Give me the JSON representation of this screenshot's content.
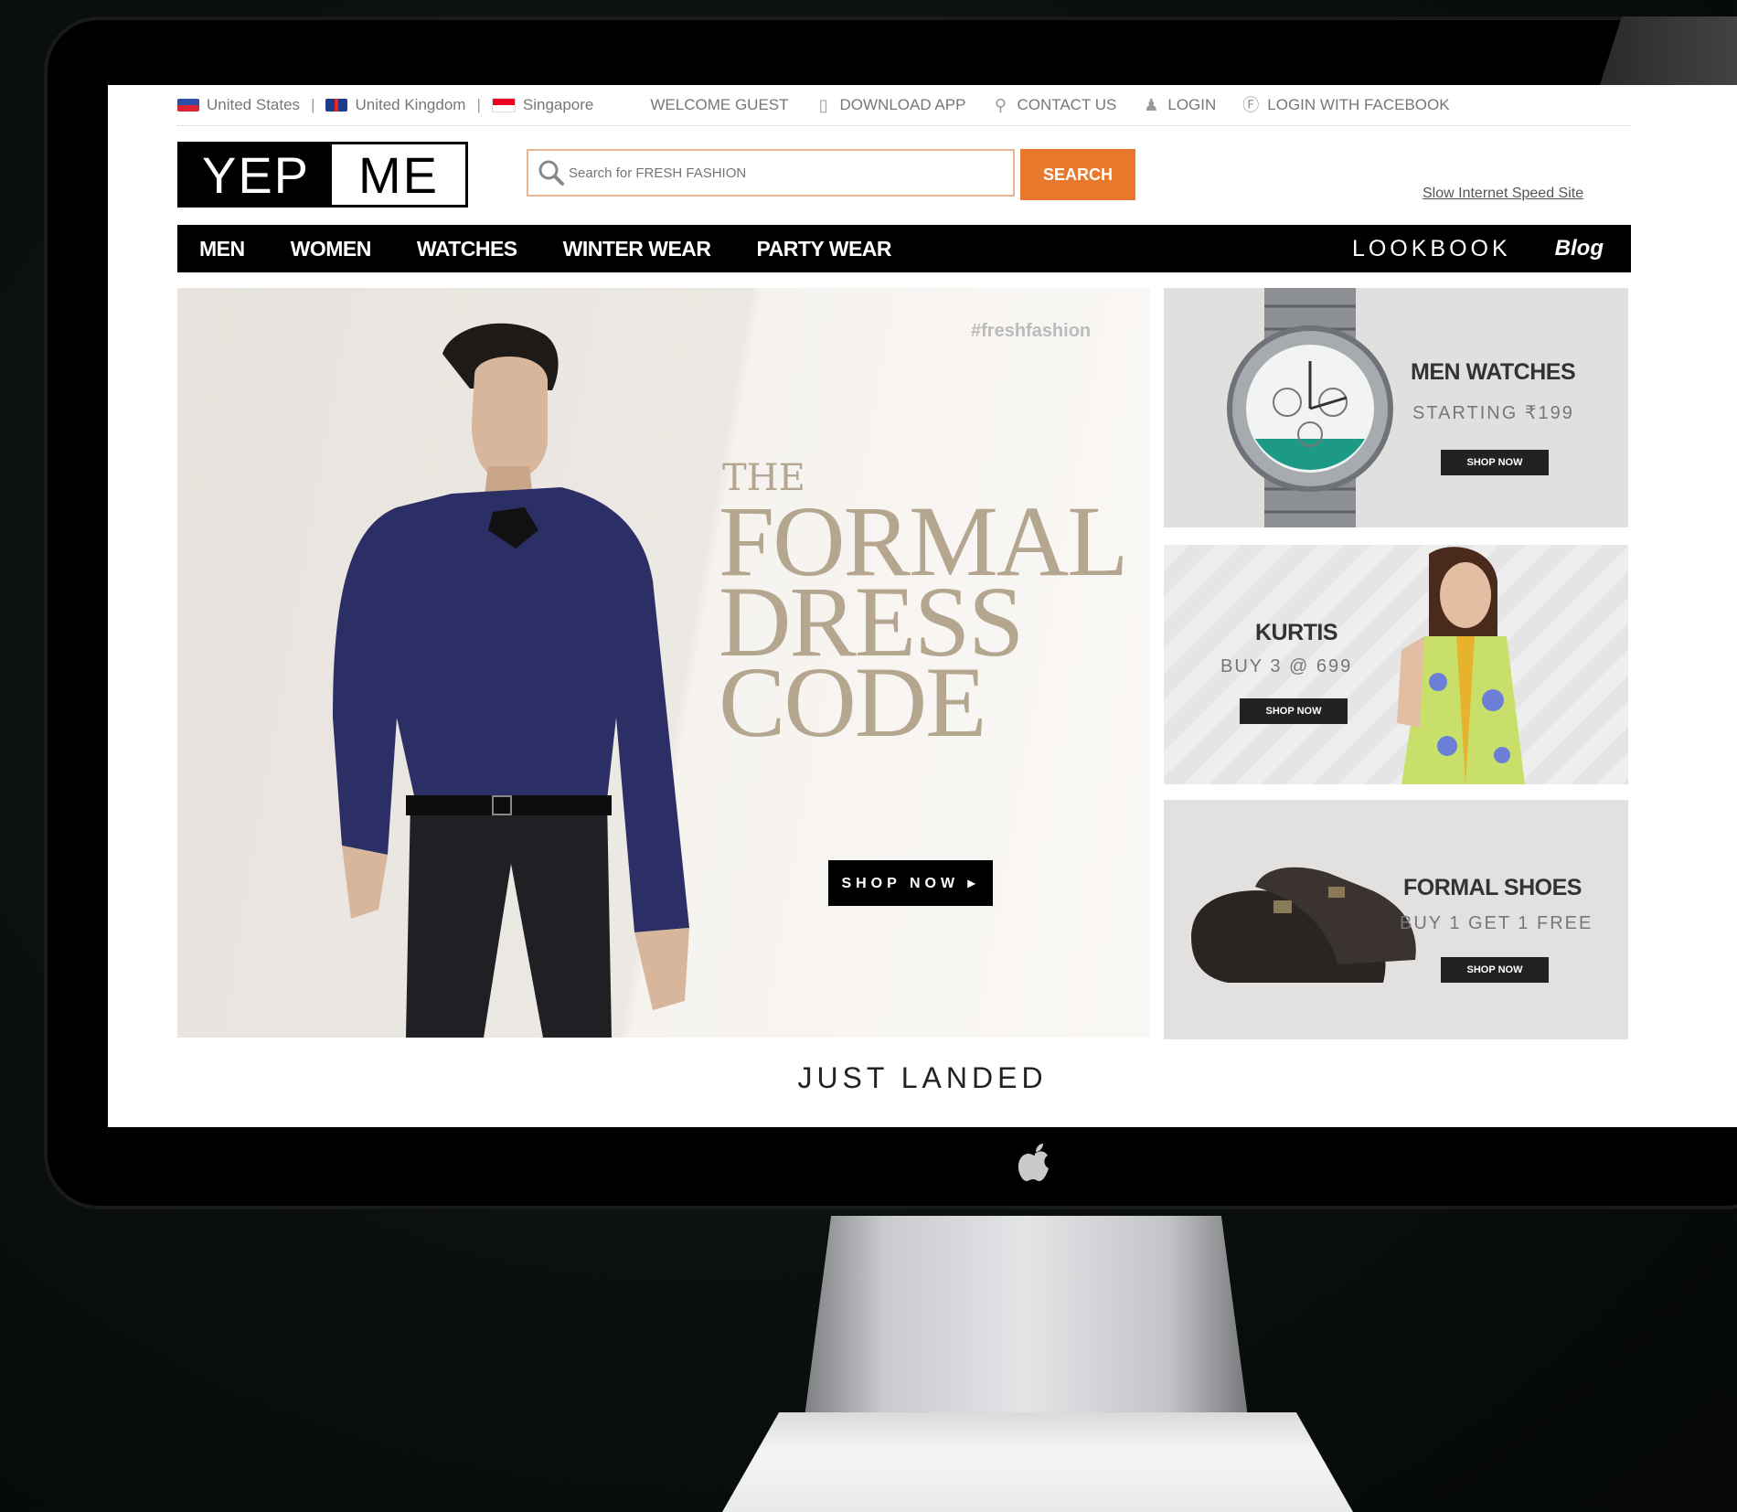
{
  "topbar": {
    "countries": [
      "United States",
      "United Kingdom",
      "Singapore"
    ],
    "welcome": "WELCOME GUEST",
    "download_app": "DOWNLOAD APP",
    "contact_us": "CONTACT US",
    "login": "LOGIN",
    "login_facebook": "LOGIN WITH FACEBOOK"
  },
  "logo": {
    "part1": "YEP",
    "part2": "ME"
  },
  "search": {
    "placeholder": "Search for FRESH FASHION",
    "button": "SEARCH"
  },
  "slow_site": "Slow Internet Speed Site",
  "nav": {
    "items": [
      "MEN",
      "WOMEN",
      "WATCHES",
      "WINTER WEAR",
      "PARTY WEAR"
    ],
    "lookbook": "LOOKBOOK",
    "blog": "Blog"
  },
  "hero": {
    "hashtag": "#freshfashion",
    "line1": "THE",
    "line2": "FORMAL",
    "line3": "DRESS",
    "line4": "CODE",
    "button": "SHOP NOW ▸"
  },
  "tiles": [
    {
      "title": "MEN WATCHES",
      "subtitle": "STARTING ₹199",
      "button": "SHOP NOW"
    },
    {
      "title": "KURTIS",
      "subtitle": "BUY 3 @ 699",
      "button": "SHOP NOW"
    },
    {
      "title": "FORMAL SHOES",
      "subtitle": "BUY 1 GET 1 FREE",
      "button": "SHOP NOW"
    }
  ],
  "section": {
    "just_landed": "JUST LANDED"
  },
  "colors": {
    "accent": "#e8782c",
    "nav_bg": "#000000",
    "headline": "#b5a690"
  }
}
